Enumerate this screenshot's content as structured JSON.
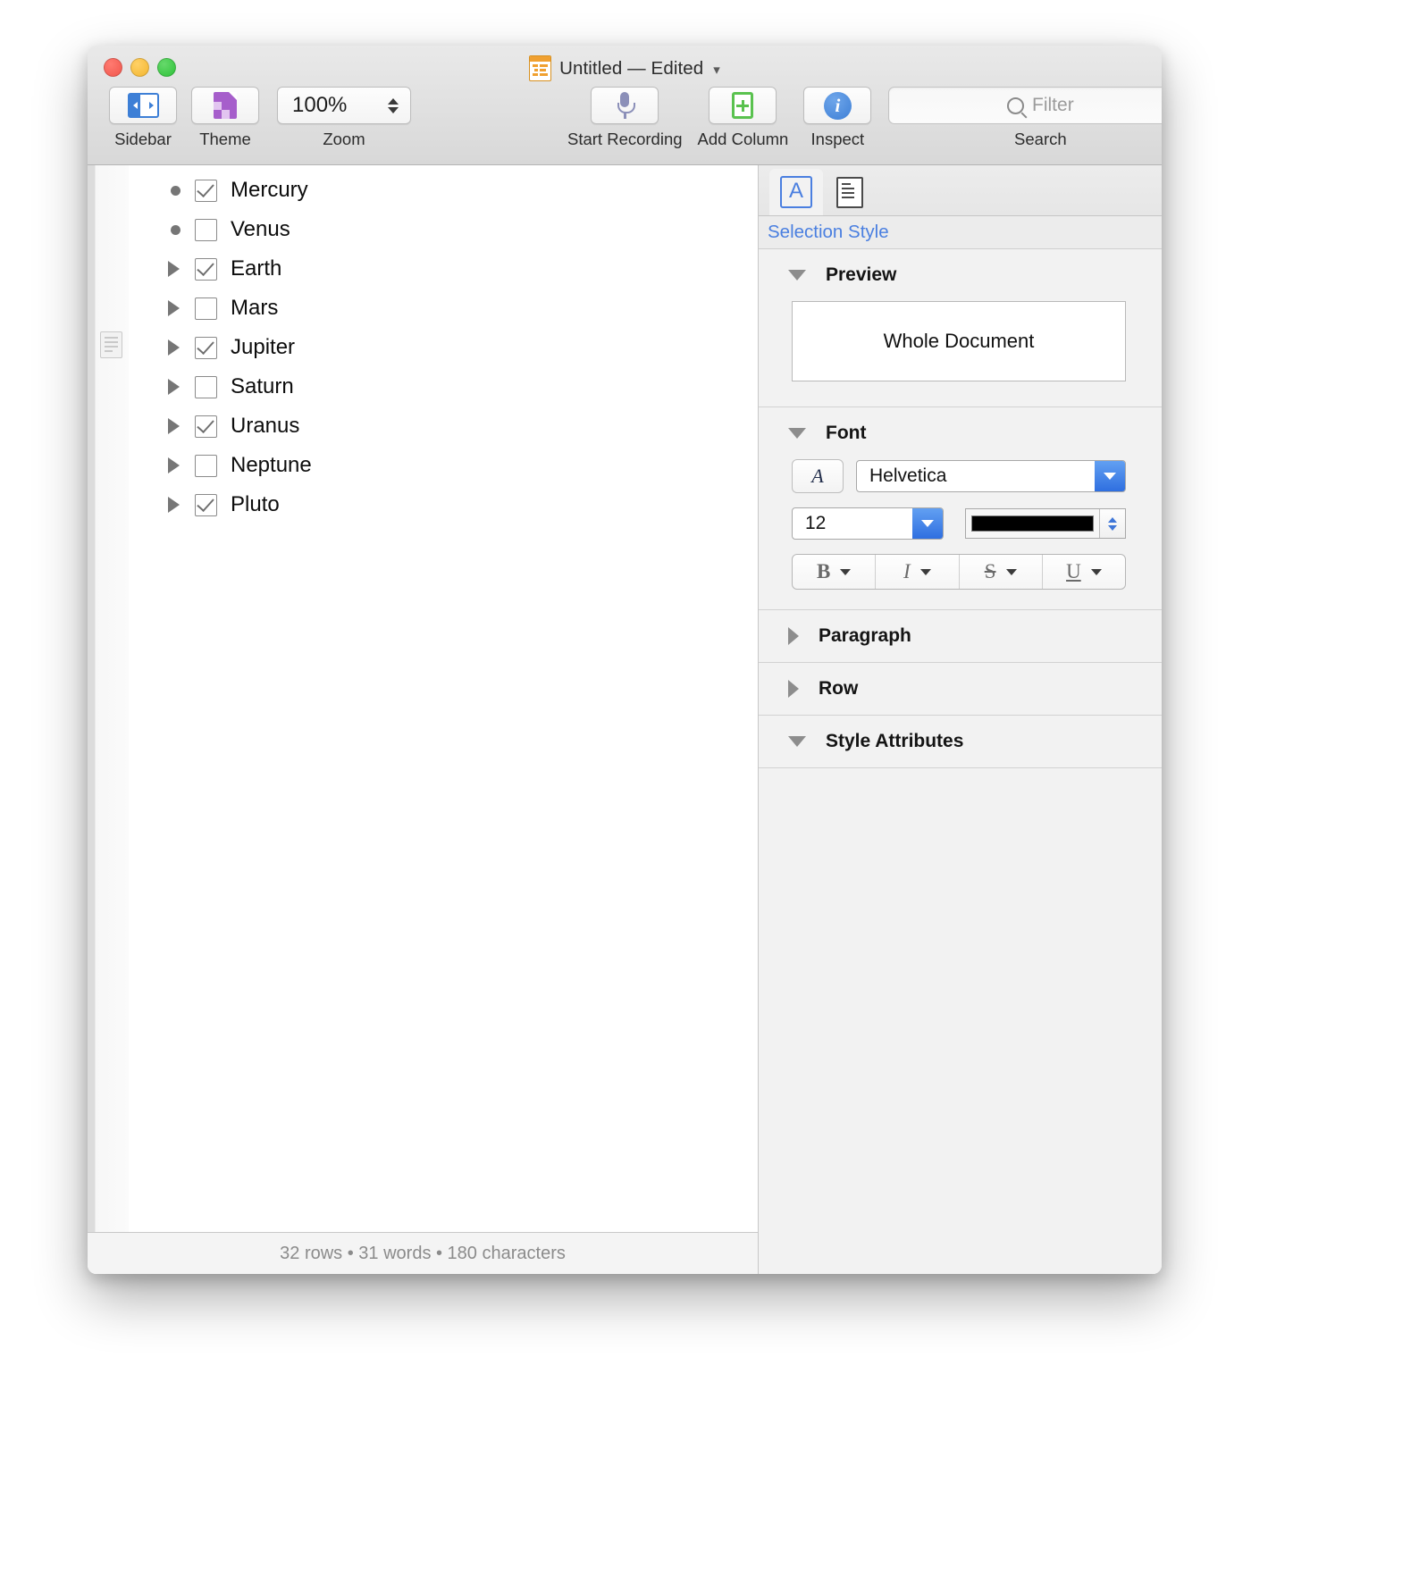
{
  "window": {
    "title": "Untitled — Edited",
    "title_chevron": "chevron-down"
  },
  "toolbar": {
    "sidebar_label": "Sidebar",
    "theme_label": "Theme",
    "zoom_label": "Zoom",
    "zoom_value": "100%",
    "record_label": "Start Recording",
    "add_column_label": "Add Column",
    "inspect_label": "Inspect",
    "search_label": "Search",
    "search_placeholder": "Filter",
    "search_value": ""
  },
  "outline": {
    "rows": [
      {
        "label": "Mercury",
        "marker": "dot",
        "checked": true
      },
      {
        "label": "Venus",
        "marker": "dot",
        "checked": false
      },
      {
        "label": "Earth",
        "marker": "triangle",
        "checked": true
      },
      {
        "label": "Mars",
        "marker": "triangle",
        "checked": false
      },
      {
        "label": "Jupiter",
        "marker": "triangle",
        "checked": true
      },
      {
        "label": "Saturn",
        "marker": "triangle",
        "checked": false
      },
      {
        "label": "Uranus",
        "marker": "triangle",
        "checked": true
      },
      {
        "label": "Neptune",
        "marker": "triangle",
        "checked": false
      },
      {
        "label": "Pluto",
        "marker": "triangle",
        "checked": true
      }
    ],
    "note_row_index": 1
  },
  "status": {
    "text": "32 rows • 31 words • 180 characters",
    "rows": "32 rows",
    "words": "31 words",
    "characters": "180 characters"
  },
  "inspector": {
    "tabs": [
      {
        "icon": "letter-a-icon",
        "active": true
      },
      {
        "icon": "document-page-icon",
        "active": false
      }
    ],
    "subtitle": "Selection Style",
    "sections": [
      {
        "title": "Preview",
        "expanded": true
      },
      {
        "title": "Font",
        "expanded": true
      },
      {
        "title": "Paragraph",
        "expanded": false
      },
      {
        "title": "Row",
        "expanded": false
      },
      {
        "title": "Style Attributes",
        "expanded": true
      }
    ],
    "preview": {
      "text": "Whole Document"
    },
    "font": {
      "family_button_glyph": "A",
      "family": "Helvetica",
      "size": "12",
      "color": "#000000",
      "styles": [
        {
          "glyph": "B",
          "name": "bold"
        },
        {
          "glyph": "I",
          "name": "italic"
        },
        {
          "glyph": "S",
          "name": "strikethrough"
        },
        {
          "glyph": "U",
          "name": "underline"
        }
      ]
    }
  },
  "colors": {
    "accent_blue": "#4a7fe0",
    "window_chrome": "#ececec",
    "inspector_bg": "#f2f2f2",
    "text_primary": "#0d0d0d",
    "text_muted": "#8b8b8b"
  }
}
